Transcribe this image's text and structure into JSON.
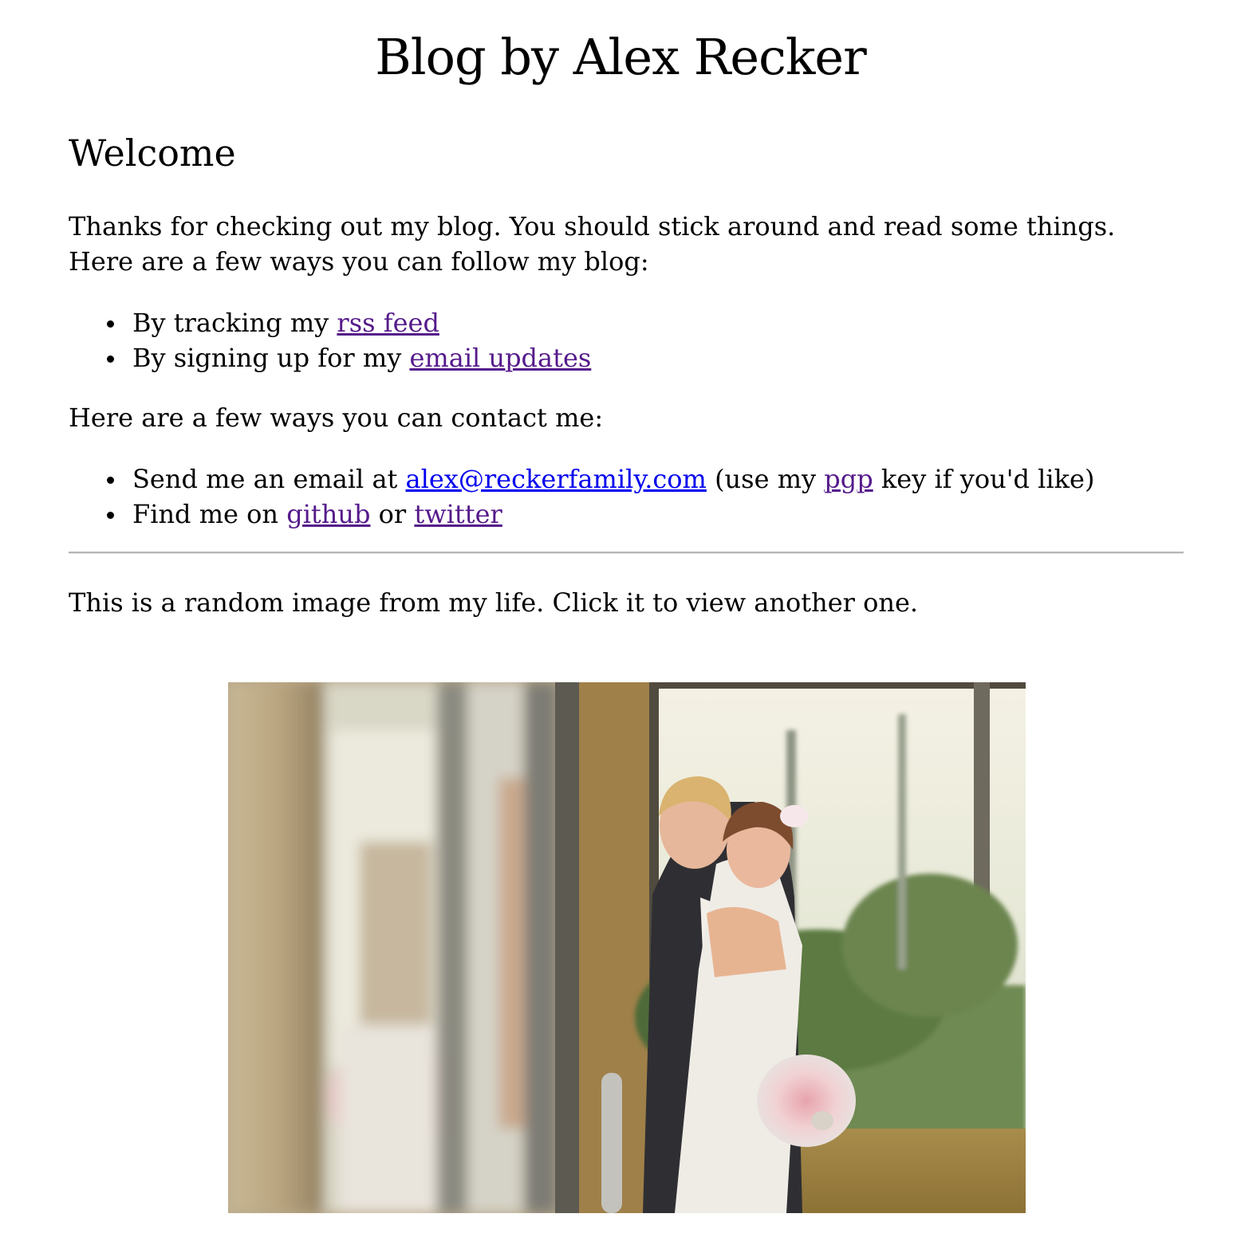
{
  "site": {
    "title": "Blog by Alex Recker"
  },
  "welcome": {
    "heading": "Welcome",
    "intro": "Thanks for checking out my blog. You should stick around and read some things. Here are a few ways you can follow my blog:"
  },
  "follow": [
    {
      "text": "By tracking my ",
      "link": "rss feed"
    },
    {
      "text": "By signing up for my ",
      "link": "email updates"
    }
  ],
  "contact": {
    "intro": "Here are a few ways you can contact me:",
    "email": {
      "prefix": "Send me an email at ",
      "address": "alex@reckerfamily.com",
      "middle": " (use my ",
      "pgp": "pgp",
      "suffix": " key if you'd like)"
    },
    "social": {
      "prefix": "Find me on ",
      "github": "github",
      "joiner": " or ",
      "twitter": "twitter"
    }
  },
  "random_image": {
    "caption": "This is a random image from my life. Click it to view another one."
  },
  "colors": {
    "visited_link": "#551a8b",
    "unvisited_link": "#0000ee",
    "divider": "#b5b5b5"
  }
}
